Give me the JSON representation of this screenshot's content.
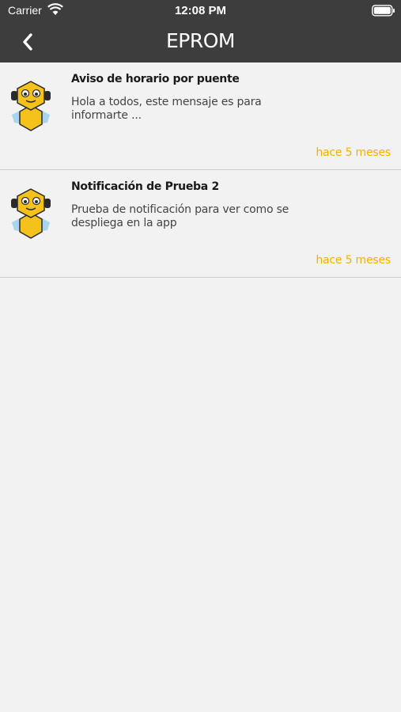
{
  "status_bar": {
    "carrier": "Carrier",
    "time": "12:08 PM",
    "icons": [
      "wifi-icon",
      "battery-icon"
    ]
  },
  "nav": {
    "title": "EPROM",
    "back_icon": "chevron-left-icon"
  },
  "colors": {
    "header_bg": "#3d3d3d",
    "page_bg": "#f2f2f2",
    "accent_time": "#f2b000",
    "mascot_yellow": "#f5c21b"
  },
  "notifications": [
    {
      "title": "Aviso de horario por puente",
      "body": "Hola a todos, este mensaje es para informarte ...",
      "time": "hace 5 meses",
      "avatar": "bee-robot-mascot-icon"
    },
    {
      "title": "Notificación de Prueba 2",
      "body": "Prueba de notificación para ver como se despliega en la app",
      "time": "hace 5 meses",
      "avatar": "bee-robot-mascot-icon"
    }
  ]
}
